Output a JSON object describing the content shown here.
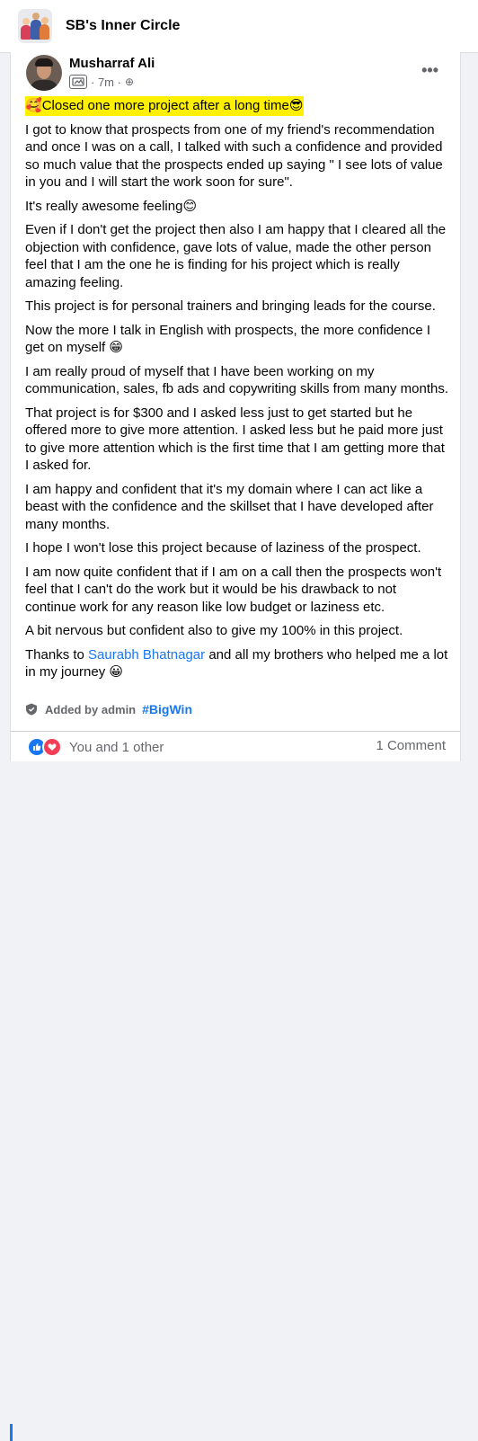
{
  "group": {
    "name": "SB's Inner Circle",
    "thumbnail_icon": "group-photo"
  },
  "post": {
    "author": "Musharraf Ali",
    "badge_icon": "badge-icon",
    "time": "· 7m ·",
    "audience_icon": "globe-icon",
    "more_icon": "more-options-icon",
    "highlight": "Closed one more project after a long time",
    "highlight_emoji_left": "🥰",
    "highlight_emoji_right": "😎",
    "paragraphs": [
      "I got to know that prospects from one of my friend's recommendation and once I was on a call, I talked with such a confidence and provided so much value that the prospects ended up saying \" I see lots of value in you and I will start the work soon for sure\".",
      "Even if I don't get the project then also I am happy that I cleared all the objection with confidence, gave lots of value, made the other person feel that I am the one he is finding for his project which is really amazing feeling.",
      "This project is for personal trainers and bringing leads for the course.",
      "I am really proud of myself that I have been working on my communication, sales, fb ads and copywriting skills from many months.",
      "That project is for $300 and I asked less just to get started but he offered more to give more attention. I asked less but he paid more just to give more attention which is the first time that I am getting more that I asked for.",
      "I am happy and confident that it's my domain where I can act like a beast with the confidence and the skillset that I have developed after many months.",
      "I hope I won't lose this project because of laziness of the prospect.",
      "I am now quite confident that if I am on a call then the prospects won't feel that I can't do the work but it would be his drawback to not continue work for any reason like low budget or laziness etc.",
      "A bit nervous but confident also to give my 100% in this project."
    ],
    "awesome_line": "It's really awesome feeling",
    "awesome_emoji": "😊",
    "english_line": "Now the more I talk in English with prospects, the more confidence I get on myself ",
    "english_emoji": "😁",
    "thanks_prefix": "Thanks to ",
    "thanks_mention": "Saurabh Bhatnagar",
    "thanks_suffix": " and all my brothers who helped me a lot in my journey ",
    "thanks_emoji": "😀",
    "added_by": "Added by admin",
    "hashtag": "#BigWin",
    "reactions_text": "You and 1 other",
    "comments": "1 Comment"
  },
  "colors": {
    "link": "#1877f2",
    "highlight": "#fff000",
    "secondary_text": "#65676b"
  }
}
